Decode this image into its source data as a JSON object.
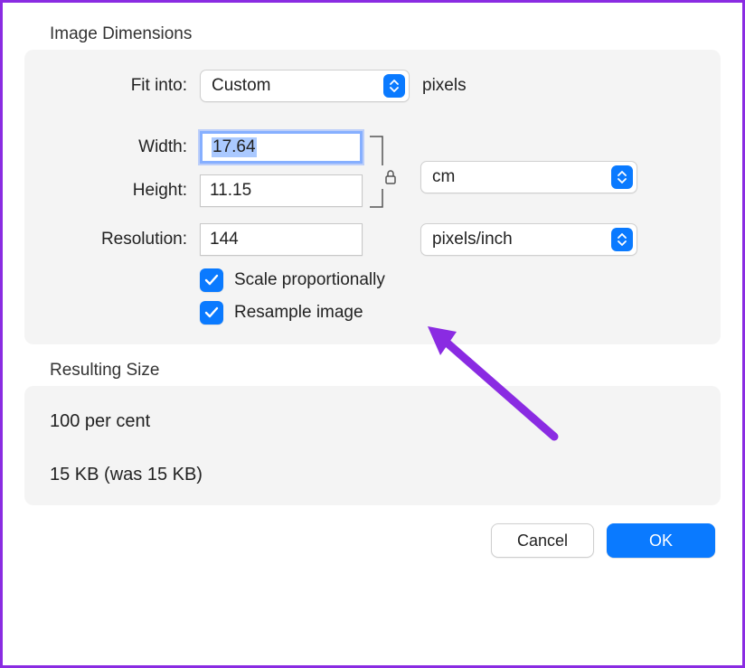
{
  "section_dimensions": {
    "title": "Image Dimensions",
    "fit_into_label": "Fit into:",
    "fit_into_value": "Custom",
    "fit_into_unit": "pixels",
    "width_label": "Width:",
    "width_value": "17.64",
    "height_label": "Height:",
    "height_value": "11.15",
    "wh_unit_select": "cm",
    "resolution_label": "Resolution:",
    "resolution_value": "144",
    "resolution_unit_select": "pixels/inch",
    "scale_prop_label": "Scale proportionally",
    "scale_prop_checked": true,
    "resample_label": "Resample image",
    "resample_checked": true
  },
  "section_resulting": {
    "title": "Resulting Size",
    "percent_line": "100 per cent",
    "size_line": "15 KB (was 15 KB)"
  },
  "buttons": {
    "cancel": "Cancel",
    "ok": "OK"
  },
  "accent_color": "#0a7aff",
  "annotation_arrow_color": "#8a2be2"
}
